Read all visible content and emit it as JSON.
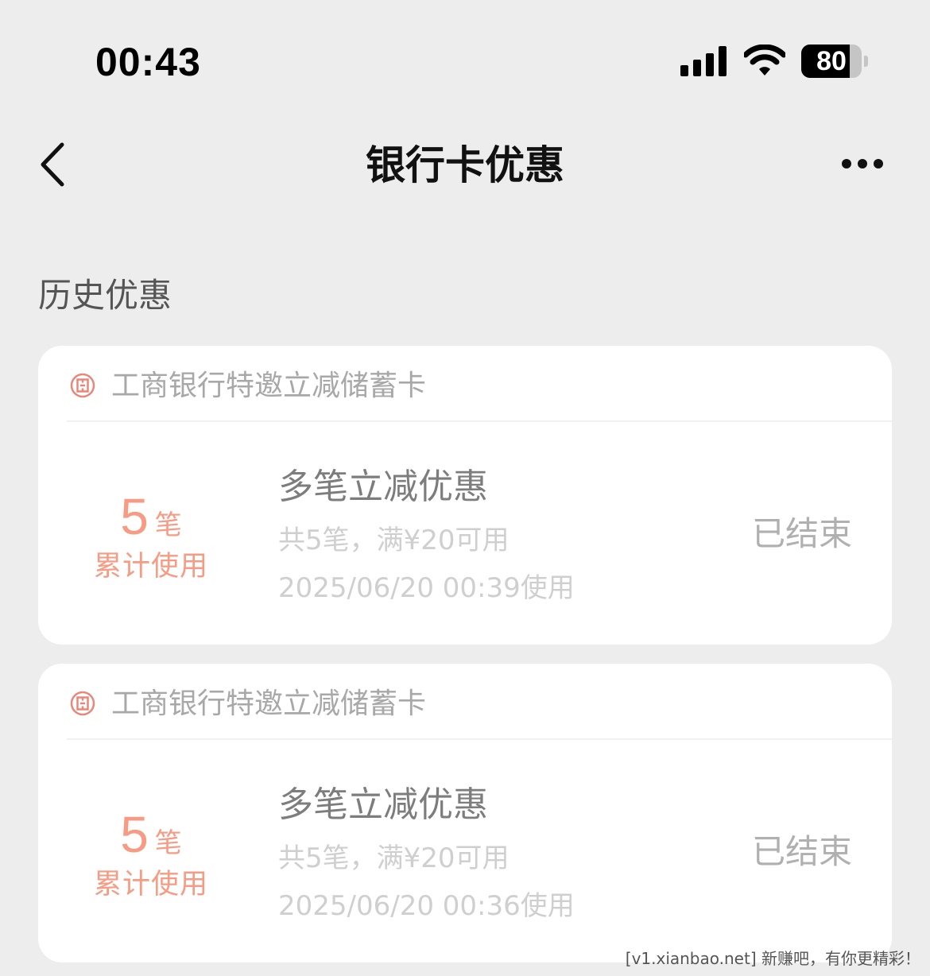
{
  "status_bar": {
    "time": "00:43",
    "battery_level": "80",
    "battery_fraction": 0.8,
    "icons": [
      "cellular-signal-icon",
      "wifi-icon",
      "battery-icon"
    ]
  },
  "nav": {
    "title": "银行卡优惠",
    "back_icon": "chevron-left-icon",
    "more_icon": "more-dots-icon"
  },
  "section_title": "历史优惠",
  "colors": {
    "background": "#ededed",
    "card": "#ffffff",
    "accent": "#f79b84",
    "bank_logo": "#e8877a"
  },
  "coupons": [
    {
      "bank": "工商银行特邀立减储蓄卡",
      "bank_icon": "icbc-logo-icon",
      "count": "5",
      "count_unit": "笔",
      "count_caption": "累计使用",
      "name": "多笔立减优惠",
      "condition": "共5笔，满¥20可用",
      "used_time": "2025/06/20 00:39使用",
      "status": "已结束"
    },
    {
      "bank": "工商银行特邀立减储蓄卡",
      "bank_icon": "icbc-logo-icon",
      "count": "5",
      "count_unit": "笔",
      "count_caption": "累计使用",
      "name": "多笔立减优惠",
      "condition": "共5笔，满¥20可用",
      "used_time": "2025/06/20 00:36使用",
      "status": "已结束"
    }
  ],
  "watermark": "[v1.xianbao.net] 新赚吧，有你更精彩！"
}
